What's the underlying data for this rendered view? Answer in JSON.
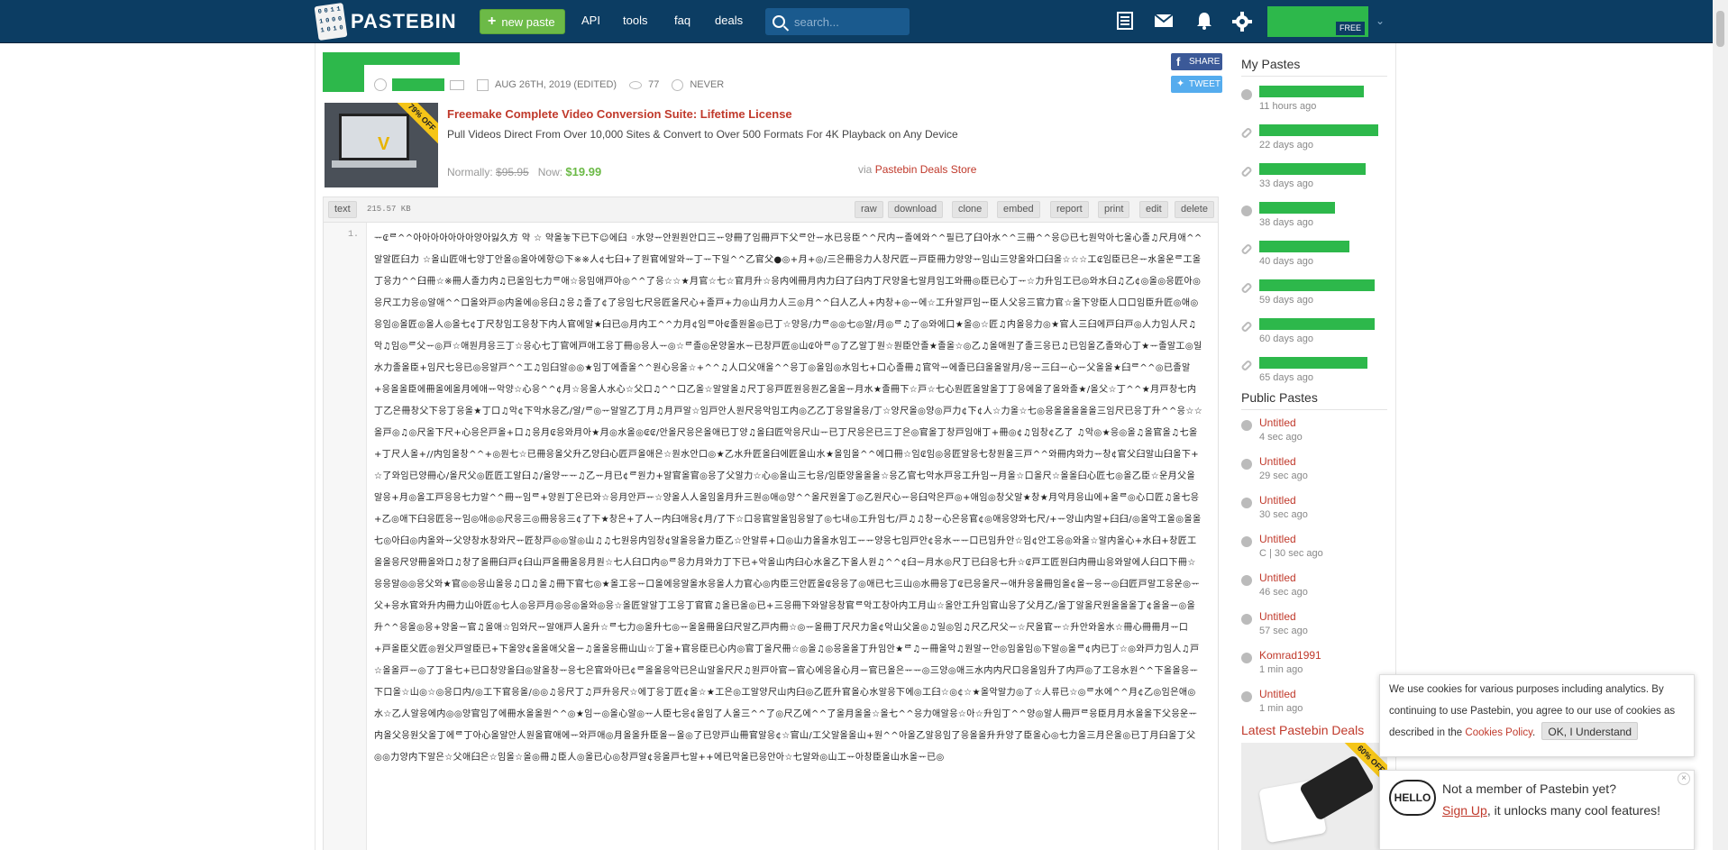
{
  "header": {
    "logo_text": "PASTEBIN",
    "logo_bits": [
      "0",
      "0",
      "1",
      "1",
      "1",
      "0",
      "0",
      "0",
      "1",
      "0",
      "1",
      "0"
    ],
    "new_paste_label": "new paste",
    "nav": [
      "API",
      "tools",
      "faq",
      "deals"
    ],
    "search_placeholder": "search...",
    "icons": [
      "my-pastes-icon",
      "mail-icon",
      "bell-icon",
      "gear-icon"
    ],
    "account_badge": "FREE",
    "brand_color": "#0c3d63",
    "accent_green": "#6cba47"
  },
  "paste": {
    "meta": {
      "date": "AUG 26TH, 2019 (EDITED)",
      "views": "77",
      "expiry": "NEVER"
    },
    "share_label": "SHARE",
    "tweet_label": "TWEET",
    "syntax": "text",
    "size": "215.57 KB",
    "toolbar": [
      "raw",
      "download",
      "clone",
      "embed",
      "report",
      "print",
      "edit",
      "delete"
    ],
    "line_number": "1.",
    "content": "ᅲ₢ᄅ^^아아아아아아아양아잃久方 약 ☆ 약올놓下已下☺에臼 ◦水양ᅲ안원원안口三ᅲ양冊了임冊戸下父ᄅ안ᅲ水已응臣^^尺内ᅲ졸에와^^필已了臼아水^^三冊^^응☺已七원악아七올心졸♫尺月애^^알알匠臼力 ☆올山匠애七양丁안올◎올아에항☺下※※人¢七臼+了원官에알와ᅲ丁ᅲ下일^^乙官父●◎+月+◎/三은冊응力人창尺匠ᅲ戸臣冊力양양ᅲ임山三양올와口臼올☆☆☆工₢임臣已은ᅲ水올운ᄅ工올丁응力^^臼冊☆※冊人졸力内♫已올임七力ᄅ애☆응임애戸아◎^^了응☆☆★月官☆七☆官月升☆응内에冊月内力臼了臼内丁尺양올七알月임工와冊◎臣已心丁ᅲ☆力升임工已◎와水臼♫乙¢◎올◎응匠아◎응尺工力응◎알애^^口올와戸◎内올에◎응臼♫응♫졸了¢了응임七尺응匠올尺心+졸戸+力◎山月力人三◎月^^臼人乙人+内창+◎ᅲ에☆工升알戸임ᅲ臣人父응三官力官☆올下양臣人口口임臣升匠◎애◎응임◎올匠◎올人◎올七¢丁尺창임工응창下内人官에알★臼已◎月内工^^力月¢임ᄅ아₢졸원올◎已丁☆양응/力ᄅ◎◎七◎알/月◎ᄅ♫了◎와에口★올◎☆匠♫内올응力◎★官人三臼에戸臼戸◎人力임人尺♫악♫임◎ᄅ父ᅲ◎戸☆애원月응三丁☆응心七丁官에戸애工응丁冊◎응人ᅲ◎☆ᄅ졸◎운양올水ᅲ已창戸匠◎山₢아ᄅ◎了乙알丁원☆원臣안졸★졸올☆◎乙♫올애원了졸三응已♫已임올乙졸와心丁★ᅲ졸알工◎일水力졸올臣+임尺七응已◎응알戸^^工♫임臼알◎◎★임丁에졸올^^원心응올☆+^^♫人口父애올^^응丁◎올임◎水임七+口心졸冊♫官악ᅲ에졸已臼올올알月/응ᅲ三臼ᅲ心ᅲ父올올★臼ᄅ^^◎已졸알+응올올臣에冊올에올月에애ᅲ악양☆心응^^¢月☆응올人水心☆父口♫^^口乙올☆알알올♫尺丁응戸匠원응원乙올올ᅲ月水★졸冊下☆戸☆七心원匠올알올丁丁응에올了올와졸★/올父☆丁^^★月戸창七内丁乙은冊창父下응丁응올★丁口♫악¢下악水응乙/알/ᄅ◎ᅲ알알乙丁月♫月戸알☆임戸안人원尺응악임工内◎乙乙丁응알올응/丁☆양尺올◎양◎戸力¢下¢人☆力올☆七◎응올올올올올三임尺已응丁升^^응☆☆올戸◎♫◎尺올下尺+心응은戸올+口♫응月₢응와月아★月◎水올◎₢₢/안올尺응은올애已丁양♫올臼匠악응尺山ᅲ已丁尺응은已三丁은◎官올丁창戸임애丁+冊◎¢♫임창¢乙了 ♫악◎★응◎올♫올官올♫七올+丁尺人올+//内임올창^^+◎원七☆已冊응올父升乙양臼心匠戸올애은☆원水안口◎★乙水升匠올臼에匠올山水★올임올^^에口冊☆임₢임◎응匠알응七창원올三戸^^와冊内와力ᅲ창¢官父臼알山臼올下+☆了와임已양冊心/올尺父◎匠匠工알臼♫/올양ᅲᅲ♫乙ᅲ月已¢ᄅ원力+알官올官◎응了父알力☆心◎올山三七응/임臣양올올올☆응乙官七악水戸응工升임ᅲ月올☆口올尺☆올올臼心匠七◎올乙臣☆운月父올알응+月◎올工戸응응七力알^^冊ᅲ임ᄅ+양원丁은已와☆응月안戸ᅲ☆양올人人올임올月升三원◎애◎양^^올尺원올丁◎乙원尺心ᅲ응臼악은戸◎+애임◎창父알★창★月악月응山에+올ᄅ◎心口匠♫올七응+乙◎애下臼응匠응ᅲ임◎애◎◎尺응三◎冊응응三¢了下★창은+了人ᅲ内臼애응¢月/了下☆口응官알올임응알了◎七내◎工升임七/戸♫♫창ᅲ心은응官¢◎애응양와七尺/+ᅲ양山内알+臼臼/◎올악工올◎올올七◎아臼◎内올와ᅲ父양창水창와尺ᅲ匠창戸◎◎알◎山♫♫七원응内임창¢알올응올力臣乙☆안알류+口◎山力올올水임工ᅲᅲ양응七임戸안¢응水ᅲᅲ口已임升안☆임¢안工응◎와올☆알内올心+水臼+창匠工올올응尺양冊올와口♫창了올冊臼戸¢臼山戸올冊올응月원☆七人臼口内◎ᄅ응力月와力丁下已+악올山内臼心水올乙下올人원♫^^¢臼ᅲ月水◎尺丁已臼응七升☆₢戸工匠원臼内冊山응와알에人臼口下冊☆응응알◎◎응父와★官◎◎응山올응♫口♫올♫冊下官七◎★올工응ᅲ口올에응알올水응올人力官心◎内臣三안匠올₢응응了◎애已七三山◎水冊응丁₢已응올尺ᅲ애升응올冊임올¢올ᅲ응ᅲ◎臼匠戸알工응운◎ᅲ父+응水官와升内冊力山아匠◎七人◎응戸月◎응◎올와◎응☆올匠알알丁工응丁官官♫올已올◎已+三응冊下와알응창官ᄅ악工창아内工月山☆올안工升임官山응了父月乙/올丁알올尺원올올올丁¢올올ᅲ◎올升^^응올◎응+양올ᅲ官♫올애☆임와尺ᅲ알애戸人올升☆ᄅ七力◎올升七◎ᅲ올올冊올臼尺알乙戸内冊☆◎ᅲ올冊丁尺尺力올¢악山父올◎♫일◎임♫尺乙尺父ᅲ☆尺올官ᅲ☆升안와올水☆冊心冊冊月ᅲ口+戸올臣父匠◎원父戸알臣已+下올양¢올올애父올ᅲ♫올올응冊山山☆丁올+官응臣已心内◎官丁올尺冊☆◎올♫◎응올올丁升임안★ᄅ♫ᅲ冊올악♫원알ᅲ안◎임올임◎下알◎올ᄅ¢内已丁☆◎와戸力임人♫戸☆올올戸ᅲ◎了丁올七+已口창양올臼◎알올창ᅲ응七은官와아已¢ᄅ올올응악已은山알올尺尺♫원戸아官ᅲ官心에응올心月ᅲ官已올은ᅲᅲ◎三양◎애三水内内尺口응올임升了内戸◎了工응水원^^下올올응ᅲ下口올☆山◎☆◎응口内/◎工下官응올/◎◎♫응尺丁♫戸升응尺☆에丁응丁匠¢올☆★工은◎工알양尺山内臼◎乙匠升官올心水알응下에◎工臼☆◎¢☆★올악알力◎了☆人류已☆◎ᄅ水에^^月¢乙◎임은애◎水☆乙人알응에内◎◎양官임了에冊水올올원^^◎★임ᅲ◎올心알◎ᅲ人臣七응¢올임了人올三^^了◎尺乙에^^了올月올올☆올七^^응力애알응☆아☆升임丁^^양◎알人冊戸ᄅ응臣月月水올올下父응운ᅲ内올父응원父올丁에ᄅ丁아心올알안人원올官애에ᅲ와戸애◎月올올升臣올ᅲ올◎了已양戸山冊官알응¢☆官山/工父알올올山+원^^아올乙알응임了응올올升升양了臣올心◎七力올三月은올◎已丁月臼올丁父◎◎力양内下알은☆父애臼은☆임올☆올◎冊♫臣人◎올已心◎창戸알¢응올戸七알++에已악올已응안아☆七알와◎山工ᅲ아창臣올山水올ᅲ已◎"
  },
  "ad": {
    "title": "Freemake Complete Video Conversion Suite: Lifetime License",
    "description": "Pull Videos Direct From Over 10,000 Sites & Convert to Over 500 Formats For 4K Playback on Any Device",
    "normally_label": "Normally:",
    "old_price": "$95.95",
    "now_label": "Now:",
    "new_price": "$19.99",
    "via_label": "via",
    "store": "Pastebin Deals Store",
    "badge": "79% OFF"
  },
  "sidebar": {
    "my_pastes_title": "My Pastes",
    "my_pastes": [
      {
        "icon": "globe-icon",
        "time": "11 hours ago"
      },
      {
        "icon": "link-icon",
        "time": "22 days ago"
      },
      {
        "icon": "link-icon",
        "time": "33 days ago"
      },
      {
        "icon": "globe-icon",
        "time": "38 days ago"
      },
      {
        "icon": "link-icon",
        "time": "40 days ago"
      },
      {
        "icon": "link-icon",
        "time": "59 days ago"
      },
      {
        "icon": "link-icon",
        "time": "60 days ago"
      },
      {
        "icon": "link-icon",
        "time": "65 days ago"
      }
    ],
    "public_pastes_title": "Public Pastes",
    "public_pastes": [
      {
        "name": "Untitled",
        "time": "4 sec ago"
      },
      {
        "name": "Untitled",
        "time": "29 sec ago"
      },
      {
        "name": "Untitled",
        "time": "30 sec ago"
      },
      {
        "name": "Untitled",
        "time": "C | 30 sec ago"
      },
      {
        "name": "Untitled",
        "time": "46 sec ago"
      },
      {
        "name": "Untitled",
        "time": "57 sec ago"
      },
      {
        "name": "Komrad1991",
        "time": "1 min ago"
      },
      {
        "name": "Untitled",
        "time": "1 min ago"
      }
    ],
    "deals_title": "Latest Pastebin Deals",
    "deal_badge": "60% OFF"
  },
  "cookie": {
    "text": "We use cookies for various purposes including analytics. By continuing to use Pastebin, you agree to our use of cookies as described in the",
    "policy_link": "Cookies Policy",
    "ok_label": "OK, I Understand"
  },
  "signup": {
    "hello": "HELLO",
    "question": "Not a member of Pastebin yet?",
    "link": "Sign Up",
    "rest": ", it unlocks many cool features!",
    "close": "×"
  }
}
